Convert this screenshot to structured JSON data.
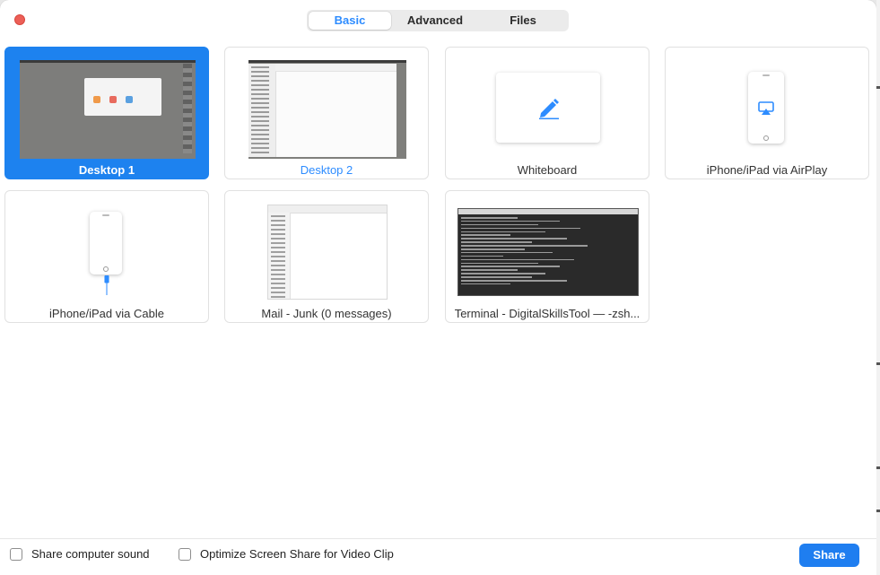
{
  "tabs": [
    {
      "label": "Basic",
      "active": true
    },
    {
      "label": "Advanced",
      "active": false
    },
    {
      "label": "Files",
      "active": false
    }
  ],
  "sources": [
    {
      "label": "Desktop 1",
      "selected": true
    },
    {
      "label": "Desktop 2",
      "selected": false
    },
    {
      "label": "Whiteboard",
      "selected": false
    },
    {
      "label": "iPhone/iPad via AirPlay",
      "selected": false
    },
    {
      "label": "iPhone/iPad via Cable",
      "selected": false
    },
    {
      "label": "Mail - Junk (0 messages)",
      "selected": false
    },
    {
      "label": "Terminal - DigitalSkillsTool — -zsh...",
      "selected": false
    }
  ],
  "footer": {
    "share_sound_label": "Share computer sound",
    "share_sound_checked": false,
    "optimize_label": "Optimize Screen Share for Video Clip",
    "optimize_checked": false,
    "share_button_label": "Share"
  },
  "colors": {
    "accent": "#1d82ef",
    "close": "#ec5f57",
    "tab_active_text": "#2d8cff"
  }
}
